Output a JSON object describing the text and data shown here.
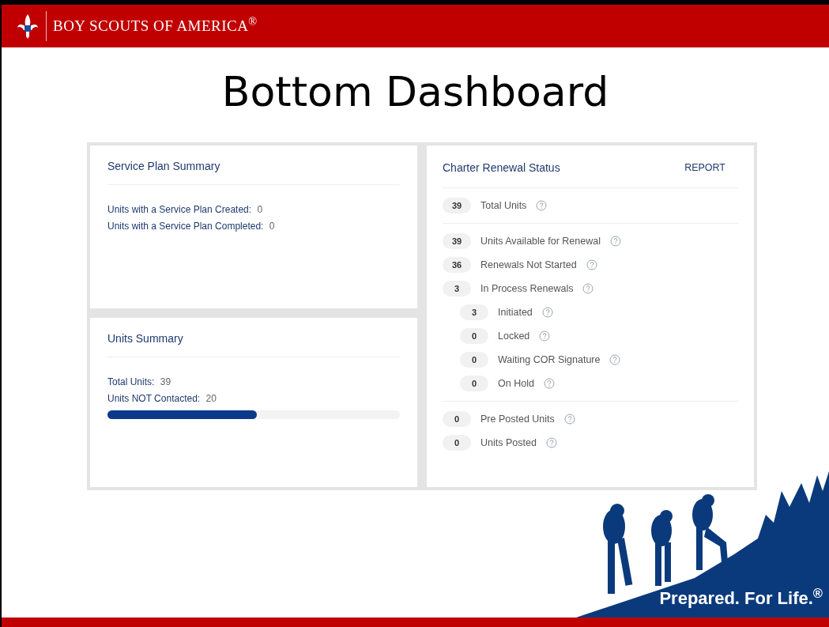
{
  "header": {
    "brand": "BOY SCOUTS OF AMERICA$^{®}$"
  },
  "slide_title": "Bottom Dashboard",
  "service_plan": {
    "title": "Service Plan Summary",
    "lines": [
      {
        "label": "Units with a Service Plan Created:",
        "value": "0"
      },
      {
        "label": "Units with a Service Plan Completed:",
        "value": "0"
      }
    ]
  },
  "units_summary": {
    "title": "Units Summary",
    "lines": [
      {
        "label": "Total Units:",
        "value": "39"
      },
      {
        "label": "Units NOT Contacted:",
        "value": "20"
      }
    ],
    "level": 0.51
  },
  "charter_renewal": {
    "title": "Charter Renewal Status",
    "report_link": "REPORT",
    "sections": [
      {
        "rows": [
          {
            "count": "39",
            "label": "Total Units"
          }
        ]
      },
      {
        "rows": [
          {
            "count": "39",
            "label": "Units Available for Renewal"
          },
          {
            "count": "36",
            "label": "Renewals Not Started"
          },
          {
            "count": "3",
            "label": "In Process Renewals",
            "children": [
              {
                "count": "3",
                "label": "Initiated"
              },
              {
                "count": "0",
                "label": "Locked"
              },
              {
                "count": "0",
                "label": "Waiting COR Signature"
              },
              {
                "count": "0",
                "label": "On Hold"
              }
            ]
          }
        ]
      },
      {
        "rows": [
          {
            "count": "0",
            "label": "Pre Posted Units"
          },
          {
            "count": "0",
            "label": "Units Posted"
          }
        ]
      }
    ]
  },
  "footer": {
    "tagline": "Prepared. For Life.$^{®}$"
  }
}
